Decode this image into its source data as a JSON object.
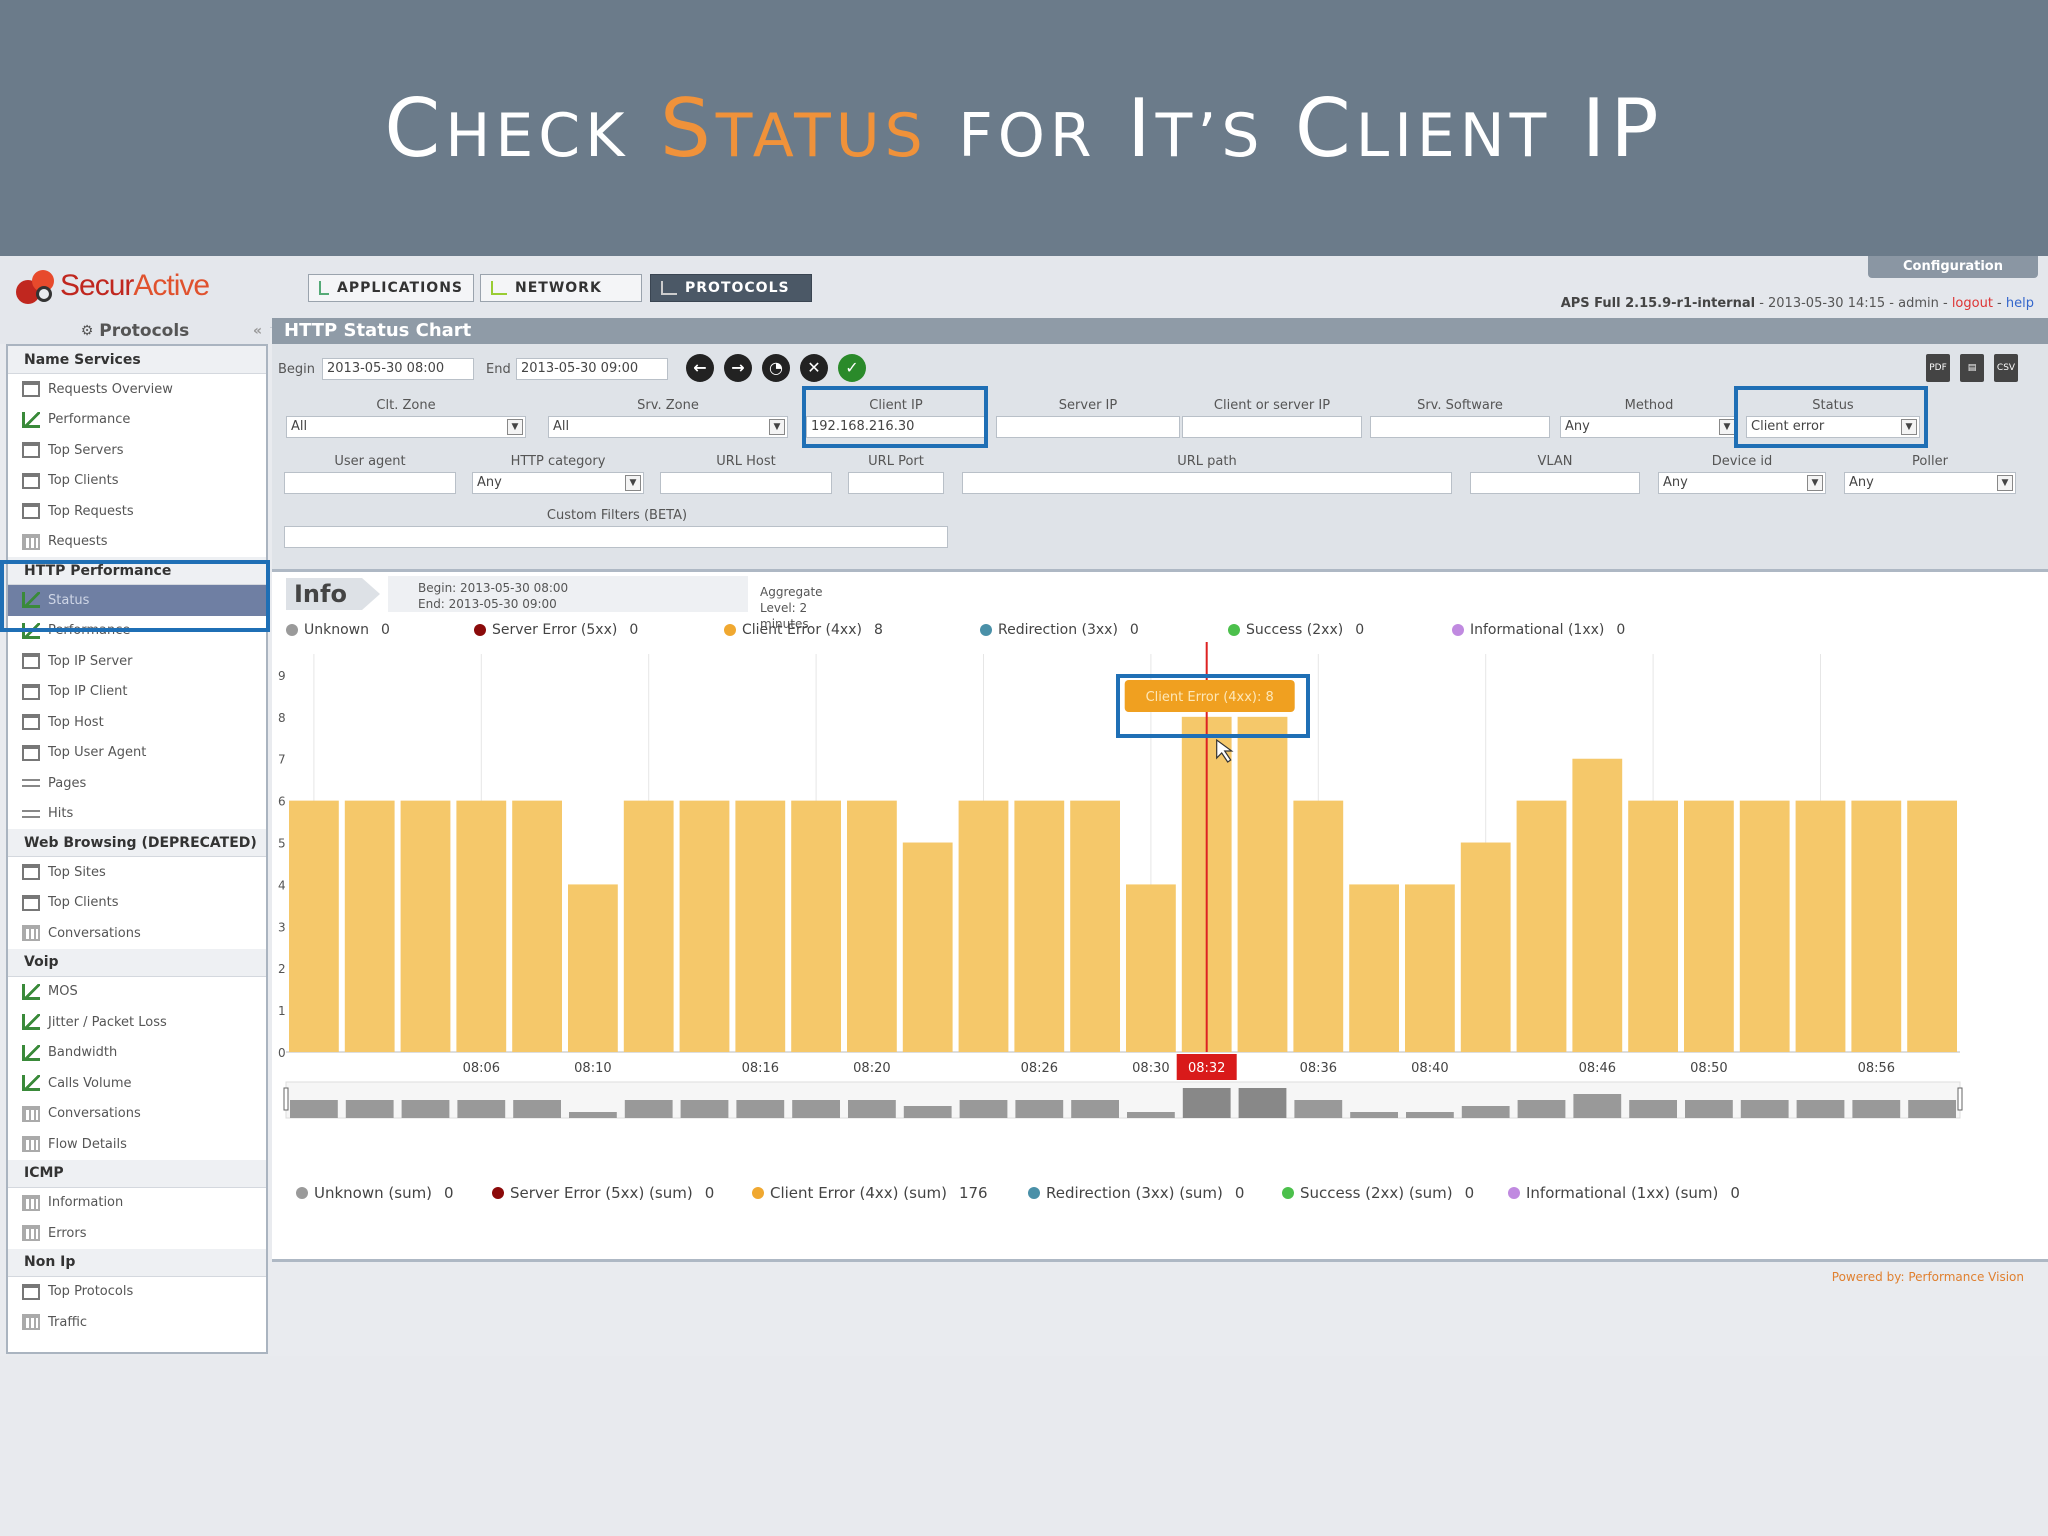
{
  "slide": {
    "title_parts": [
      {
        "cap": "C",
        "rest": "HECK",
        "accent": false
      },
      {
        "cap": "S",
        "rest": "TATUS",
        "accent": true
      },
      {
        "cap": "",
        "rest": "FOR",
        "accent": false
      },
      {
        "cap": "I",
        "rest": "T’S",
        "accent": false
      },
      {
        "cap": "C",
        "rest": "LIENT",
        "accent": false
      },
      {
        "cap": "IP",
        "rest": "",
        "accent": false
      }
    ]
  },
  "app": {
    "logo_a": "Secur",
    "logo_b": "Active",
    "tabs": [
      "APPLICATIONS",
      "NETWORK",
      "PROTOCOLS"
    ],
    "config_label": "Configuration",
    "version": "APS Full 2.15.9-r1-internal",
    "version_meta": " - 2013-05-30 14:15 - admin - ",
    "logout": "logout",
    "help": "help"
  },
  "sidebar": {
    "title": "Protocols",
    "sections": [
      {
        "name": "Name Services",
        "items": [
          {
            "label": "Requests Overview",
            "icon": "table"
          },
          {
            "label": "Performance",
            "icon": "chart"
          },
          {
            "label": "Top Servers",
            "icon": "table"
          },
          {
            "label": "Top Clients",
            "icon": "table"
          },
          {
            "label": "Top Requests",
            "icon": "table"
          },
          {
            "label": "Requests",
            "icon": "grid"
          }
        ]
      },
      {
        "name": "HTTP Performance",
        "items": [
          {
            "label": "Status",
            "icon": "chart",
            "selected": true
          },
          {
            "label": "Performance",
            "icon": "chart"
          },
          {
            "label": "Top IP Server",
            "icon": "table"
          },
          {
            "label": "Top IP Client",
            "icon": "table"
          },
          {
            "label": "Top Host",
            "icon": "table"
          },
          {
            "label": "Top User Agent",
            "icon": "table"
          },
          {
            "label": "Pages",
            "icon": "arrows"
          },
          {
            "label": "Hits",
            "icon": "arrows"
          }
        ]
      },
      {
        "name": "Web Browsing (DEPRECATED)",
        "items": [
          {
            "label": "Top Sites",
            "icon": "table"
          },
          {
            "label": "Top Clients",
            "icon": "table"
          },
          {
            "label": "Conversations",
            "icon": "grid"
          }
        ]
      },
      {
        "name": "Voip",
        "items": [
          {
            "label": "MOS",
            "icon": "chart"
          },
          {
            "label": "Jitter / Packet Loss",
            "icon": "chart"
          },
          {
            "label": "Bandwidth",
            "icon": "chart"
          },
          {
            "label": "Calls Volume",
            "icon": "chart"
          },
          {
            "label": "Conversations",
            "icon": "grid"
          },
          {
            "label": "Flow Details",
            "icon": "grid"
          }
        ]
      },
      {
        "name": "ICMP",
        "items": [
          {
            "label": "Information",
            "icon": "grid"
          },
          {
            "label": "Errors",
            "icon": "grid"
          }
        ]
      },
      {
        "name": "Non Ip",
        "items": [
          {
            "label": "Top Protocols",
            "icon": "table"
          },
          {
            "label": "Traffic",
            "icon": "grid"
          }
        ]
      }
    ]
  },
  "main": {
    "title": "HTTP Status Chart",
    "begin_label": "Begin",
    "begin_value": "2013-05-30 08:00",
    "end_label": "End",
    "end_value": "2013-05-30 09:00",
    "filters_row1": [
      {
        "label": "Clt. Zone",
        "value": "All",
        "type": "select"
      },
      {
        "label": "Srv. Zone",
        "value": "All",
        "type": "select"
      },
      {
        "label": "Client IP",
        "value": "192.168.216.30",
        "type": "text"
      },
      {
        "label": "Server IP",
        "value": "",
        "type": "text"
      },
      {
        "label": "Client or server IP",
        "value": "",
        "type": "text"
      },
      {
        "label": "Srv. Software",
        "value": "",
        "type": "text"
      },
      {
        "label": "Method",
        "value": "Any",
        "type": "select"
      },
      {
        "label": "Status",
        "value": "Client error",
        "type": "select"
      }
    ],
    "filters_row2": [
      {
        "label": "User agent",
        "value": "",
        "type": "text"
      },
      {
        "label": "HTTP category",
        "value": "Any",
        "type": "select"
      },
      {
        "label": "URL Host",
        "value": "",
        "type": "text"
      },
      {
        "label": "URL Port",
        "value": "",
        "type": "text"
      },
      {
        "label": "URL path",
        "value": "",
        "type": "text"
      },
      {
        "label": "VLAN",
        "value": "",
        "type": "text"
      },
      {
        "label": "Device id",
        "value": "Any",
        "type": "select"
      },
      {
        "label": "Poller",
        "value": "Any",
        "type": "select"
      }
    ],
    "custom_filters_label": "Custom Filters (BETA)",
    "info_label": "Info",
    "info_begin": "Begin: 2013-05-30 08:00",
    "info_end": "End: 2013-05-30 09:00",
    "aggregate": "Aggregate Level: 2 minutes",
    "legend": [
      {
        "name": "Unknown",
        "value": "0",
        "color": "#9a9a9a"
      },
      {
        "name": "Server Error (5xx)",
        "value": "0",
        "color": "#8b0a0a"
      },
      {
        "name": "Client Error (4xx)",
        "value": "8",
        "color": "#f0a830"
      },
      {
        "name": "Redirection (3xx)",
        "value": "0",
        "color": "#4a90a8"
      },
      {
        "name": "Success (2xx)",
        "value": "0",
        "color": "#4cc04c"
      },
      {
        "name": "Informational (1xx)",
        "value": "0",
        "color": "#c08ae0"
      }
    ],
    "sum_legend": [
      {
        "name": "Unknown (sum)",
        "value": "0",
        "color": "#9a9a9a"
      },
      {
        "name": "Server Error (5xx) (sum)",
        "value": "0",
        "color": "#8b0a0a"
      },
      {
        "name": "Client Error (4xx) (sum)",
        "value": "176",
        "color": "#f0a830"
      },
      {
        "name": "Redirection (3xx) (sum)",
        "value": "0",
        "color": "#4a90a8"
      },
      {
        "name": "Success (2xx) (sum)",
        "value": "0",
        "color": "#4cc04c"
      },
      {
        "name": "Informational (1xx) (sum)",
        "value": "0",
        "color": "#c08ae0"
      }
    ],
    "tooltip": "Client Error (4xx): 8",
    "footer_label": "Powered by: ",
    "footer_brand": "Performance Vision"
  },
  "chart_data": {
    "type": "bar",
    "categories": [
      "08:00",
      "08:02",
      "08:04",
      "08:06",
      "08:08",
      "08:10",
      "08:12",
      "08:14",
      "08:16",
      "08:18",
      "08:20",
      "08:22",
      "08:24",
      "08:26",
      "08:28",
      "08:30",
      "08:32",
      "08:34",
      "08:36",
      "08:38",
      "08:40",
      "08:42",
      "08:44",
      "08:46",
      "08:48",
      "08:50",
      "08:52",
      "08:54",
      "08:56",
      "08:58"
    ],
    "tick_labels": [
      "08:06",
      "08:10",
      "08:16",
      "08:20",
      "08:26",
      "08:30",
      "08:32",
      "08:36",
      "08:40",
      "08:46",
      "08:50",
      "08:56"
    ],
    "series": [
      {
        "name": "Client Error (4xx)",
        "color": "#f5c86a",
        "values": [
          6,
          6,
          6,
          6,
          6,
          4,
          6,
          6,
          6,
          6,
          6,
          5,
          6,
          6,
          6,
          4,
          8,
          8,
          6,
          4,
          4,
          5,
          6,
          7,
          6,
          6,
          6,
          6,
          6,
          6
        ]
      }
    ],
    "yticks": [
      0,
      1,
      2,
      3,
      4,
      5,
      6,
      7,
      8,
      9
    ],
    "ylim": [
      0,
      9.5
    ],
    "highlight_category": "08:32"
  }
}
